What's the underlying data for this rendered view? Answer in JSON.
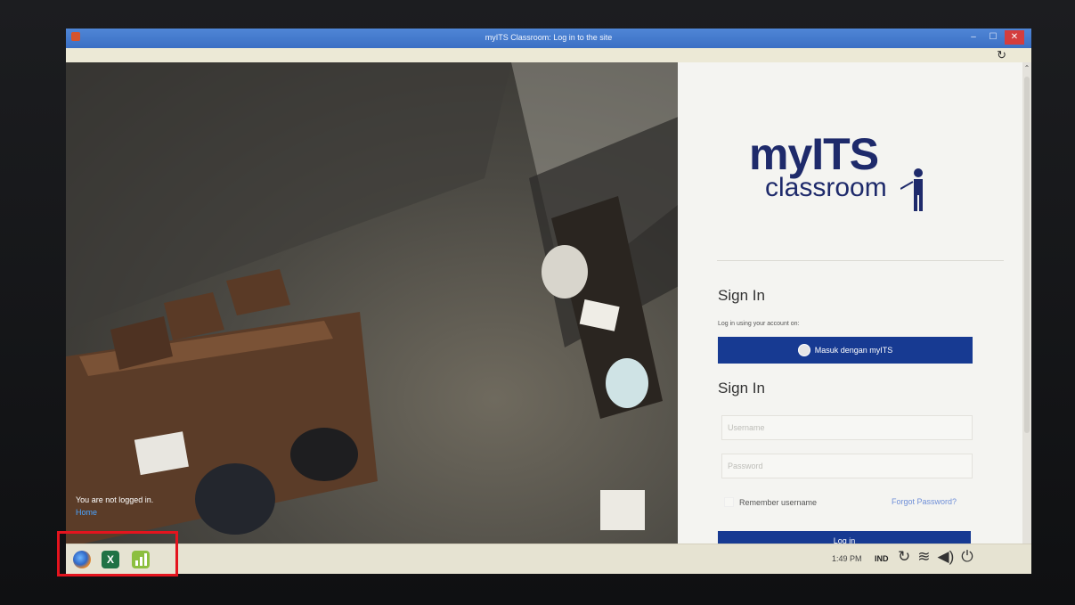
{
  "window": {
    "title": "myITS Classroom: Log in to the site",
    "min_label": "–",
    "max_label": "☐",
    "close_label": "✕",
    "reload_icon": "↻"
  },
  "photo_overlay": {
    "not_logged_in": "You are not logged in.",
    "home_link": "Home"
  },
  "logo": {
    "main": "myITS",
    "sub": "classroom"
  },
  "sso": {
    "heading": "Sign In",
    "hint": "Log in using your account on:",
    "button_label": "Masuk dengan myITS"
  },
  "login_form": {
    "heading": "Sign In",
    "username_placeholder": "Username",
    "password_placeholder": "Password",
    "remember_label": "Remember username",
    "forgot_link": "Forgot Password?",
    "submit_label": "Log in"
  },
  "taskbar": {
    "apps": [
      "firefox-icon",
      "excel-icon",
      "chart-app-icon"
    ],
    "excel_glyph": "X",
    "clock": "1:49 PM",
    "language": "IND",
    "tray": {
      "refresh": "↻",
      "wifi": "≋",
      "volume": "◀)",
      "power": "⏻"
    }
  },
  "colors": {
    "brand_navy": "#1e2a6b",
    "button_blue": "#173a92",
    "link_blue": "#6f8fd8",
    "titlebar": "#3b6fc4",
    "highlight_red": "#e4141e"
  }
}
